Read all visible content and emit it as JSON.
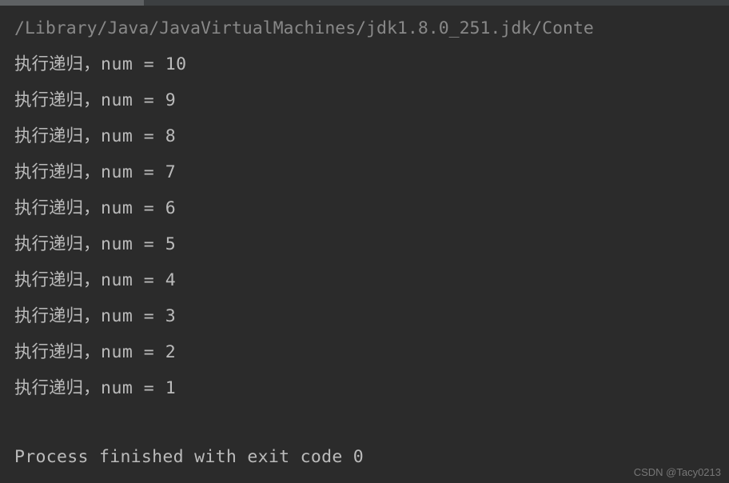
{
  "console": {
    "command": "/Library/Java/JavaVirtualMachines/jdk1.8.0_251.jdk/Conte",
    "output_prefix": "执行递归",
    "output_separator": "，",
    "output_var": "num = ",
    "lines": [
      {
        "value": "10"
      },
      {
        "value": "9"
      },
      {
        "value": "8"
      },
      {
        "value": "7"
      },
      {
        "value": "6"
      },
      {
        "value": "5"
      },
      {
        "value": "4"
      },
      {
        "value": "3"
      },
      {
        "value": "2"
      },
      {
        "value": "1"
      }
    ],
    "exit_message": "Process finished with exit code 0"
  },
  "watermark": "CSDN @Tacy0213"
}
